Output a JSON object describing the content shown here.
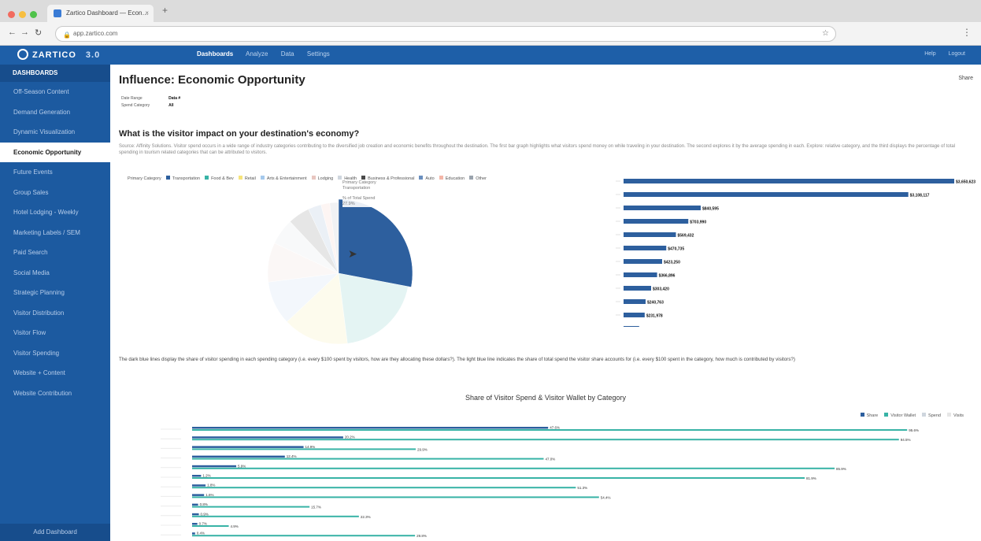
{
  "browser": {
    "tab_title": "Zartico Dashboard — Econ…",
    "url": "app.zartico.com",
    "colors": {
      "close": "#f26b5f",
      "minimize": "#f7be3f",
      "maximize": "#4fc24a"
    }
  },
  "app": {
    "logo": "ZARTICO",
    "version": "3.0",
    "nav": [
      "Dashboards",
      "Analyze",
      "Data",
      "Settings"
    ],
    "active_nav": "Dashboards",
    "right_links": [
      "Help",
      "Logout"
    ],
    "brand_color": "#1e5fa8"
  },
  "sidebar": {
    "heading": "DASHBOARDS",
    "items": [
      {
        "label": "Off-Season Content"
      },
      {
        "label": "Demand Generation"
      },
      {
        "label": "Dynamic Visualization"
      },
      {
        "label": "Economic Opportunity",
        "active": true
      },
      {
        "label": "Future Events"
      },
      {
        "label": "Group Sales"
      },
      {
        "label": "Hotel Lodging - Weekly"
      },
      {
        "label": "Marketing Labels / SEM"
      },
      {
        "label": "Paid Search"
      },
      {
        "label": "Social Media"
      },
      {
        "label": "Strategic Planning"
      },
      {
        "label": "Visitor Distribution"
      },
      {
        "label": "Visitor Flow"
      },
      {
        "label": "Visitor Spending"
      },
      {
        "label": "Website + Content"
      },
      {
        "label": "Website Contribution"
      }
    ],
    "footer": "Add Dashboard"
  },
  "page": {
    "title": "Influence: Economic Opportunity",
    "share": "Share",
    "meta": [
      {
        "label": "Date Range",
        "value": "Data #"
      },
      {
        "label": "Spend Category",
        "value": "All"
      }
    ],
    "question": "What is the visitor impact on your destination's economy?",
    "description": "Source: Affinity Solutions. Visitor spend occurs in a wide range of industry categories contributing to the diversified job creation and economic benefits throughout the destination. The first bar graph highlights what visitors spend money on while traveling in your destination. The second explores it by the average spending in each. Explore: relative category, and the third displays the percentage of total spending in tourism related categories that can be attributed to visitors.",
    "note": "The dark blue lines display the share of visitor spending in each spending category (i.e. every $100 spent by visitors, how are they allocating these dollars?). The light blue line indicates the share of total spend the visitor share accounts for (i.e. every $100 spent in the category, how much is contributed by visitors?)"
  },
  "chart_data": [
    {
      "type": "pie",
      "legend_title": "Primary Category",
      "legend": [
        {
          "name": "Transportation",
          "color": "#2d5f9e"
        },
        {
          "name": "Food & Bev",
          "color": "#38b3a6"
        },
        {
          "name": "Retail",
          "color": "#f6e47b"
        },
        {
          "name": "Arts & Entertainment",
          "color": "#a5c9ec"
        },
        {
          "name": "Lodging",
          "color": "#e8c6c0"
        },
        {
          "name": "Health",
          "color": "#cfd6de"
        },
        {
          "name": "Business & Professional",
          "color": "#4a4a4a"
        },
        {
          "name": "Auto",
          "color": "#6a8fbf"
        },
        {
          "name": "Education",
          "color": "#f4b6a8"
        },
        {
          "name": "Other",
          "color": "#9aa3ad"
        }
      ],
      "values": [
        28,
        20,
        15,
        10,
        9,
        6,
        5,
        3,
        2,
        2
      ],
      "tooltip": {
        "label": "Primary Category",
        "category": "Transportation",
        "measure": "% of Total Spend",
        "value": "27.9%"
      }
    },
    {
      "type": "bar",
      "orientation": "horizontal",
      "values": [
        3600000,
        3100000,
        840000,
        705000,
        570000,
        465000,
        420000,
        365000,
        300000,
        240000,
        230000,
        170000
      ],
      "data_labels": [
        "$3,650,623",
        "$3,108,117",
        "$840,595",
        "$703,990",
        "$569,432",
        "$470,735",
        "$423,250",
        "$366,896",
        "$303,420",
        "$240,763",
        "$231,978",
        "$174,318"
      ]
    },
    {
      "type": "bar",
      "orientation": "horizontal",
      "title": "Share of Visitor Spend & Visitor Wallet by Category",
      "legend": [
        {
          "name": "Share",
          "color": "#2d5f9e"
        },
        {
          "name": "Visitor Wallet",
          "color": "#38b3a6"
        },
        {
          "name": "Spend",
          "color": "#cfd6de"
        },
        {
          "name": "Visits",
          "color": "#e6e6e6"
        }
      ],
      "series": [
        {
          "name": "Share",
          "values": [
            47.6,
            20.2,
            14.9,
            12.4,
            5.9,
            1.2,
            1.8,
            1.6,
            0.8,
            0.9,
            0.7,
            0.4
          ]
        },
        {
          "name": "Visitor Wallet",
          "values": [
            95.6,
            94.5,
            29.9,
            47.0,
            85.9,
            81.9,
            51.3,
            54.4,
            15.7,
            22.3,
            4.9,
            29.8
          ]
        }
      ],
      "data_labels_share": [
        "47.6%",
        "20.2%",
        "14.9%",
        "12.4%",
        "5.9%",
        "1.2%",
        "1.8%",
        "1.6%",
        "0.8%",
        "0.9%",
        "0.7%",
        "0.4%"
      ],
      "data_labels_wallet": [
        "95.6%",
        "94.5%",
        "29.9%",
        "47.0%",
        "85.9%",
        "81.9%",
        "51.3%",
        "54.4%",
        "15.7%",
        "22.3%",
        "4.9%",
        "29.8%"
      ]
    }
  ]
}
